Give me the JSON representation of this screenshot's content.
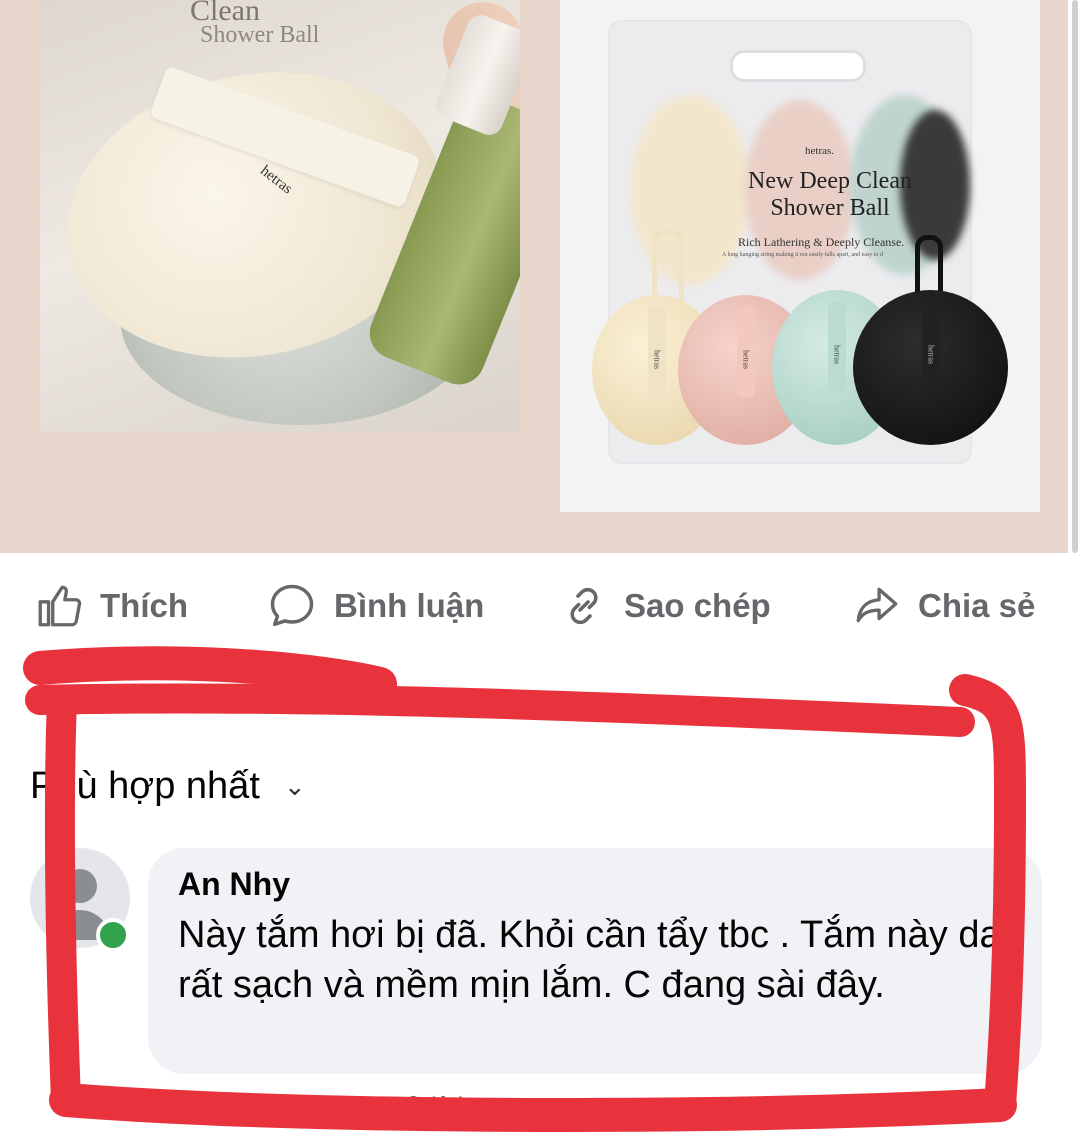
{
  "product_image": {
    "box_print_line1": "Clean",
    "box_print_line2": "Shower Ball",
    "brand": "hetras",
    "package_brand": "hetras.",
    "package_title_line1": "New Deep Clean",
    "package_title_line2": "Shower Ball",
    "package_subtitle": "Rich Lathering & Deeply Cleanse.",
    "package_tiny_text": "A long hanging string making it not easily falls apart, and easy to d",
    "ball_brand": "hetras"
  },
  "actions": {
    "like": "Thích",
    "comment": "Bình luận",
    "copy": "Sao chép",
    "share": "Chia sẻ"
  },
  "comments": {
    "sort_label": "Phù hợp nhất",
    "items": [
      {
        "author": "An Nhy",
        "text": "Này tắm hơi bị đã. Khỏi cần tẩy tbc . Tắm này da rất sạch và mềm mịn lắm. C đang sài đây.",
        "time": "1 phút",
        "reply": "Trả lời",
        "online": true
      }
    ]
  },
  "colors": {
    "media_bg": "#e8d5cc",
    "action_text": "#65676b",
    "bubble_bg": "#f0f2f5",
    "online": "#31a24c",
    "marker_red": "#e8323c"
  },
  "icons": [
    "thumbs-up-icon",
    "speech-bubble-icon",
    "link-icon",
    "share-arrow-icon",
    "chevron-down-icon",
    "avatar-silhouette-icon"
  ]
}
